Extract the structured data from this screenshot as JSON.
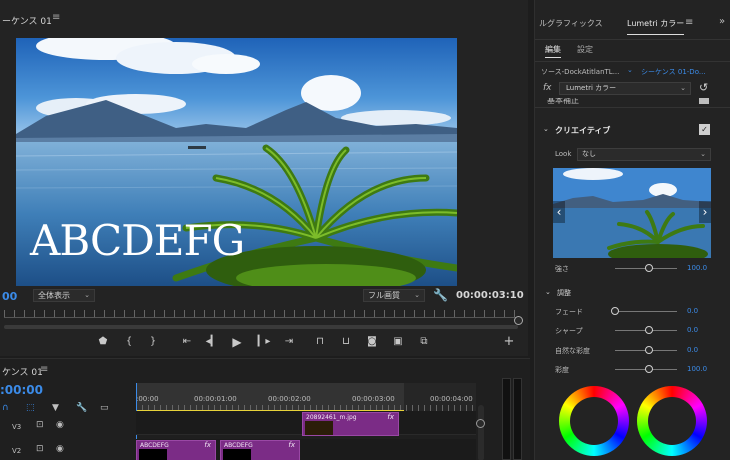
{
  "monitor": {
    "title": "ーケンス 01",
    "menu_icon": "hamburger-icon",
    "overlay_text": "ABCDEFG",
    "timecode_left": "00",
    "zoom": "全体表示",
    "resolution": "フル画質",
    "timecode_right": "00:00:03:10"
  },
  "timeline": {
    "title": "ケンス 01",
    "timecode": ":00:00",
    "ruler_labels": [
      ":00:00",
      "00:00:01:00",
      "00:00:02:00",
      "00:00:03:00",
      "00:00:04:00"
    ],
    "tracks": [
      {
        "name": "V3"
      },
      {
        "name": "V2"
      }
    ],
    "clips": {
      "image_clip": "20892461_m.jpg",
      "text_clip_1": "ABCDEFG",
      "text_clip_2": "ABCDEFG",
      "fx": "fx"
    }
  },
  "panel": {
    "tab_graphics": "ルグラフィックス",
    "tab_lumetri": "Lumetri カラー",
    "tab_menu": "≡",
    "more": "»",
    "subtab_edit": "編集",
    "subtab_settings": "設定",
    "source": "ソース-DockAtitlanTL...",
    "sequence": "シーケンス 01-Do...",
    "fx_effect": "Lumetri カラー",
    "basic_label": "基本補正",
    "creative_label": "クリエイティブ",
    "look_label": "Look",
    "look_value": "なし",
    "intensity": {
      "label": "強さ",
      "value": "100.0",
      "fraction": 0.55
    },
    "adjust_label": "調整",
    "sliders": [
      {
        "label": "フェード",
        "value": "0.0",
        "fraction": 0.0
      },
      {
        "label": "シャープ",
        "value": "0.0",
        "fraction": 0.55
      },
      {
        "label": "自然な彩度",
        "value": "0.0",
        "fraction": 0.55
      },
      {
        "label": "彩度",
        "value": "100.0",
        "fraction": 0.55
      }
    ]
  },
  "icons": {
    "wrench": "wrench-icon",
    "camera": "camera-icon",
    "play": "play-icon"
  },
  "colors": {
    "accent_blue": "#3b8be8",
    "clip_purple": "#7b2c86",
    "playhead_yellow": "#e7d33a"
  }
}
